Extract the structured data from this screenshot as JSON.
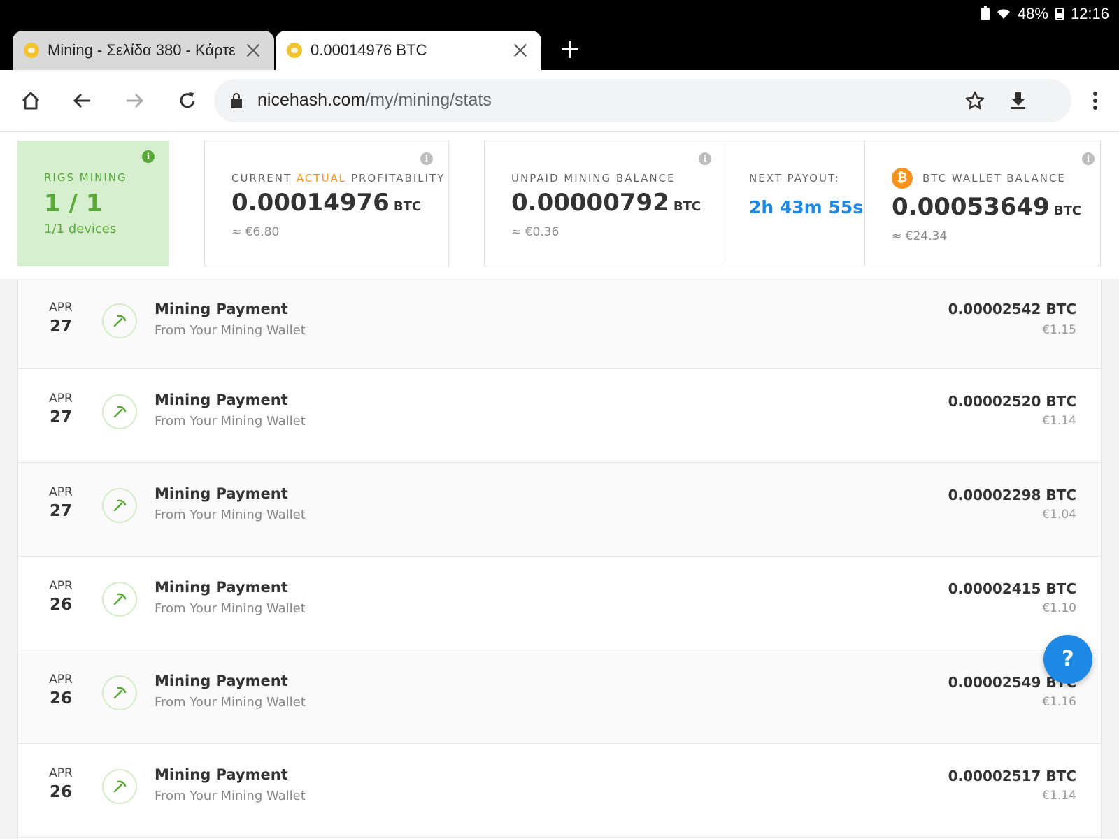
{
  "status_bar": {
    "battery": "48%",
    "time": "12:16"
  },
  "tabs": [
    {
      "title": "Mining - Σελίδα 380 - Κάρτε"
    },
    {
      "title": "0.00014976 BTC"
    }
  ],
  "address_bar": {
    "domain": "nicehash.com",
    "path": "/my/mining/stats"
  },
  "rigs": {
    "label": "RIGS MINING",
    "value": "1 / 1",
    "devices": "1/1 devices"
  },
  "profitability": {
    "label_prefix": "CURRENT ",
    "label_accent": "ACTUAL",
    "label_suffix": " PROFITABILITY /",
    "value": "0.00014976",
    "unit": "BTC",
    "fiat": "≈ €6.80"
  },
  "unpaid": {
    "label": "UNPAID MINING BALANCE",
    "value": "0.00000792",
    "unit": "BTC",
    "fiat": "≈ €0.36"
  },
  "next_payout": {
    "label": "NEXT PAYOUT:",
    "value": "2h 43m 55s"
  },
  "wallet": {
    "label": "BTC WALLET BALANCE",
    "value": "0.00053649",
    "unit": "BTC",
    "fiat": "≈ €24.34",
    "badge": "₿"
  },
  "transactions": [
    {
      "month": "APR",
      "day": "27",
      "title": "Mining Payment",
      "subtitle": "From Your Mining Wallet",
      "amount": "0.00002542 BTC",
      "fiat": "€1.15"
    },
    {
      "month": "APR",
      "day": "27",
      "title": "Mining Payment",
      "subtitle": "From Your Mining Wallet",
      "amount": "0.00002520 BTC",
      "fiat": "€1.14"
    },
    {
      "month": "APR",
      "day": "27",
      "title": "Mining Payment",
      "subtitle": "From Your Mining Wallet",
      "amount": "0.00002298 BTC",
      "fiat": "€1.04"
    },
    {
      "month": "APR",
      "day": "26",
      "title": "Mining Payment",
      "subtitle": "From Your Mining Wallet",
      "amount": "0.00002415 BTC",
      "fiat": "€1.10"
    },
    {
      "month": "APR",
      "day": "26",
      "title": "Mining Payment",
      "subtitle": "From Your Mining Wallet",
      "amount": "0.00002549 BTC",
      "fiat": "€1.16"
    },
    {
      "month": "APR",
      "day": "26",
      "title": "Mining Payment",
      "subtitle": "From Your Mining Wallet",
      "amount": "0.00002517 BTC",
      "fiat": "€1.14"
    }
  ],
  "help": {
    "label": "?"
  },
  "colors": {
    "green": "#5aa83a",
    "blue": "#1e88e5",
    "orange": "#f7931a"
  }
}
